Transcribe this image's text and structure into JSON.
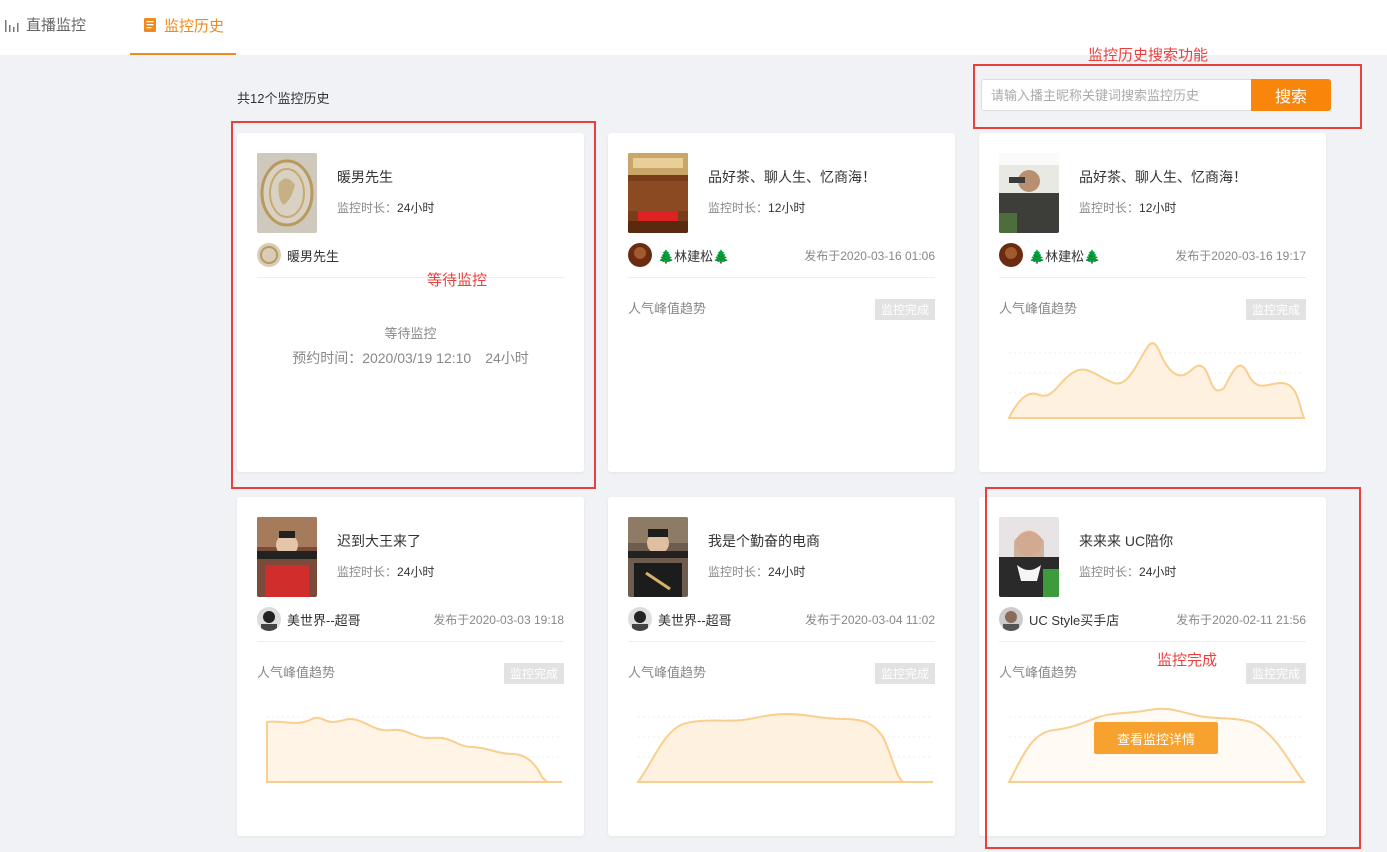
{
  "tabs": [
    {
      "label": "直播监控",
      "icon": "bar-chart-icon"
    },
    {
      "label": "监控历史",
      "icon": "document-icon",
      "active": true
    }
  ],
  "count_text": "共12个监控历史",
  "search": {
    "placeholder": "请输入播主昵称关键词搜索监控历史",
    "value": "",
    "button_label": "搜索"
  },
  "colors": {
    "accent": "#f7860b",
    "annotation": "#e8403d",
    "chart_stroke": "#f8cf8f",
    "chart_fill": "#fff1df"
  },
  "common": {
    "duration_label": "监控时长：",
    "trend_label": "人气峰值趋势",
    "done_badge": "监控完成",
    "detail_button": "查看监控详情"
  },
  "cards": [
    {
      "title": "暖男先生",
      "duration": "24小时",
      "author": "暖男先生",
      "published": "",
      "status": "waiting",
      "wait_status": "等待监控",
      "wait_time": "预约时间：2020/03/19 12:10　24小时"
    },
    {
      "title": "品好茶、聊人生、忆商海！",
      "duration": "12小时",
      "author": "🌲林建松🌲",
      "published": "发布于2020-03-16 01:06",
      "status": "done"
    },
    {
      "title": "品好茶、聊人生、忆商海！",
      "duration": "12小时",
      "author": "🌲林建松🌲",
      "published": "发布于2020-03-16 19:17",
      "status": "done"
    },
    {
      "title": "迟到大王来了",
      "duration": "24小时",
      "author": "美世界--超哥",
      "published": "发布于2020-03-03 19:18",
      "status": "done"
    },
    {
      "title": "我是个勤奋的电商",
      "duration": "24小时",
      "author": "美世界--超哥",
      "published": "发布于2020-03-04 11:02",
      "status": "done"
    },
    {
      "title": "来来来 UC陪你",
      "duration": "24小时",
      "author": "UC Style买手店",
      "published": "发布于2020-02-11 21:56",
      "status": "done",
      "show_detail_button": true
    }
  ],
  "annotations": {
    "search_feature": "监控历史搜索功能",
    "waiting": "等待监控",
    "completed": "监控完成"
  }
}
